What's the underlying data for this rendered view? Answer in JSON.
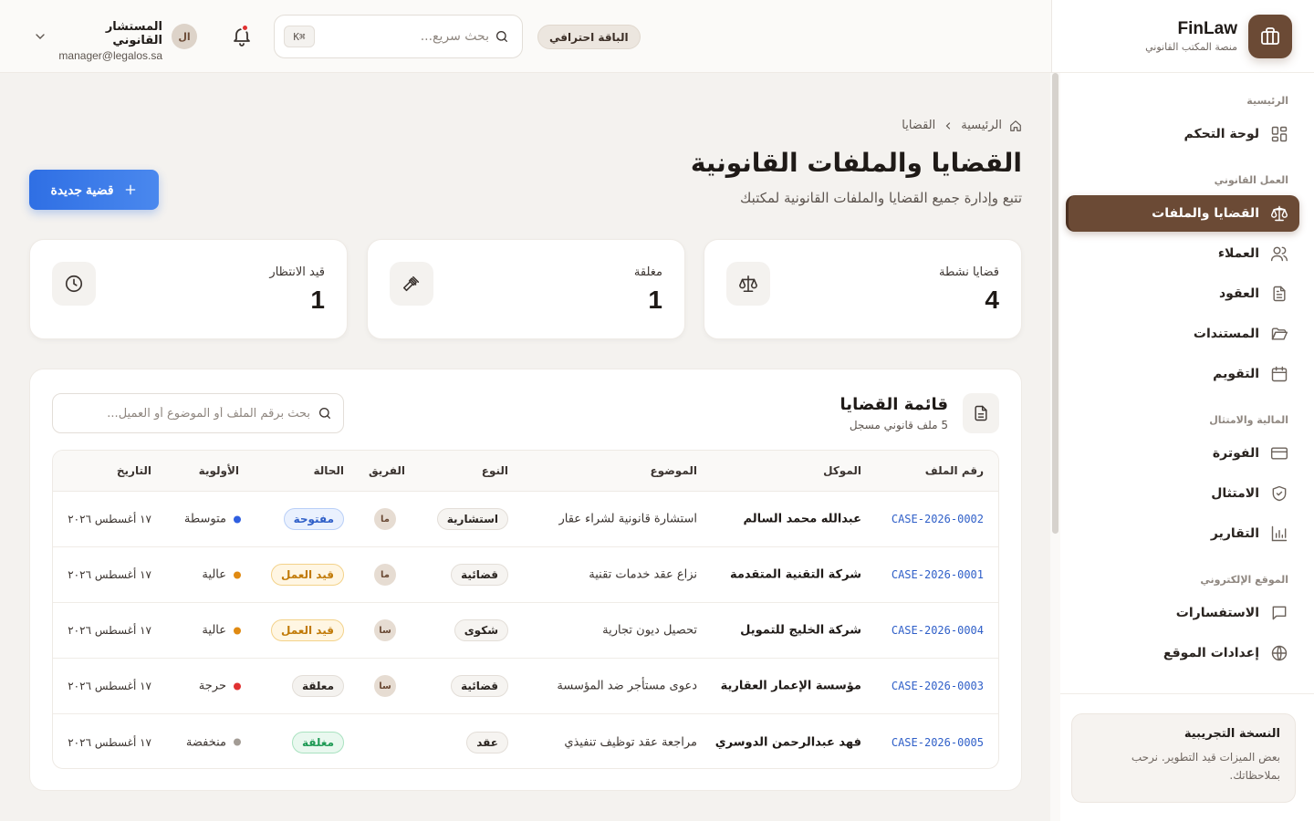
{
  "brand": {
    "name": "FinLaw",
    "subtitle": "منصة المكتب القانوني"
  },
  "nav": {
    "sections": [
      {
        "title": "الرئيسية",
        "items": [
          {
            "label": "لوحة التحكم",
            "icon": "dashboard-icon"
          }
        ]
      },
      {
        "title": "العمل القانوني",
        "items": [
          {
            "label": "القضايا والملفات",
            "icon": "scale-icon",
            "active": true
          },
          {
            "label": "العملاء",
            "icon": "users-icon"
          },
          {
            "label": "العقود",
            "icon": "file-text-icon"
          },
          {
            "label": "المستندات",
            "icon": "folder-open-icon"
          },
          {
            "label": "التقويم",
            "icon": "calendar-icon"
          }
        ]
      },
      {
        "title": "المالية والامتثال",
        "items": [
          {
            "label": "الفوترة",
            "icon": "credit-card-icon"
          },
          {
            "label": "الامتثال",
            "icon": "shield-icon"
          },
          {
            "label": "التقارير",
            "icon": "bar-chart-icon"
          }
        ]
      },
      {
        "title": "الموقع الإلكتروني",
        "items": [
          {
            "label": "الاستفسارات",
            "icon": "message-icon"
          },
          {
            "label": "إعدادات الموقع",
            "icon": "globe-icon"
          }
        ]
      }
    ]
  },
  "trial": {
    "title": "النسخة التجريبية",
    "text": "بعض الميزات قيد التطوير. نرحب بملاحظاتك."
  },
  "header": {
    "plan_badge": "الباقة احترافي",
    "search_placeholder": "بحث سريع...",
    "search_shortcut": "⌘K",
    "avatar_initials": "ال",
    "user_name": "المستشار القانوني",
    "user_email": "manager@legalos.sa"
  },
  "breadcrumb": {
    "home": "الرئيسية",
    "current": "القضايا"
  },
  "page": {
    "title": "القضايا والملفات القانونية",
    "subtitle": "تتبع وإدارة جميع القضايا والملفات القانونية لمكتبك",
    "new_button": "قضية جديدة"
  },
  "stats": [
    {
      "label": "قضايا نشطة",
      "value": "4",
      "icon": "scale-icon"
    },
    {
      "label": "مغلقة",
      "value": "1",
      "icon": "gavel-icon"
    },
    {
      "label": "قيد الانتظار",
      "value": "1",
      "icon": "clock-icon"
    }
  ],
  "table": {
    "title": "قائمة القضايا",
    "subtitle": "5 ملف قانوني مسجل",
    "search_placeholder": "بحث برقم الملف أو الموضوع أو العميل...",
    "columns": {
      "file": "رقم الملف",
      "client": "الموكل",
      "subject": "الموضوع",
      "type": "النوع",
      "team": "الفريق",
      "status": "الحالة",
      "priority": "الأولوية",
      "date": "التاريخ"
    },
    "rows": [
      {
        "file": "CASE-2026-0002",
        "client": "عبدالله محمد السالم",
        "subject": "استشارة قانونية لشراء عقار",
        "type": "استشارية",
        "team": "ما",
        "status": "مفتوحة",
        "status_kind": "open",
        "priority": "متوسطة",
        "priority_color": "#2f5fe0",
        "date": "١٧ أغسطس ٢٠٢٦"
      },
      {
        "file": "CASE-2026-0001",
        "client": "شركة التقنية المتقدمة",
        "subject": "نزاع عقد خدمات تقنية",
        "type": "قضائية",
        "team": "ما",
        "status": "قيد العمل",
        "status_kind": "progress",
        "priority": "عالية",
        "priority_color": "#e08a12",
        "date": "١٧ أغسطس ٢٠٢٦"
      },
      {
        "file": "CASE-2026-0004",
        "client": "شركة الخليج للتمويل",
        "subject": "تحصيل ديون تجارية",
        "type": "شكوى",
        "team": "سا",
        "status": "قيد العمل",
        "status_kind": "progress",
        "priority": "عالية",
        "priority_color": "#e08a12",
        "date": "١٧ أغسطس ٢٠٢٦"
      },
      {
        "file": "CASE-2026-0003",
        "client": "مؤسسة الإعمار العقارية",
        "subject": "دعوى مستأجر ضد المؤسسة",
        "type": "قضائية",
        "team": "سا",
        "status": "معلقة",
        "status_kind": "suspended",
        "priority": "حرجة",
        "priority_color": "#e03131",
        "date": "١٧ أغسطس ٢٠٢٦"
      },
      {
        "file": "CASE-2026-0005",
        "client": "فهد عبدالرحمن الدوسري",
        "subject": "مراجعة عقد توظيف تنفيذي",
        "type": "عقد",
        "team": "",
        "status": "مغلقة",
        "status_kind": "closed",
        "priority": "منخفضة",
        "priority_color": "#a39c95",
        "date": "١٧ أغسطس ٢٠٢٦"
      }
    ]
  },
  "colors": {
    "brand": "#6b4a35",
    "primary": "#2f6fe4",
    "background": "#f4f2ef"
  }
}
